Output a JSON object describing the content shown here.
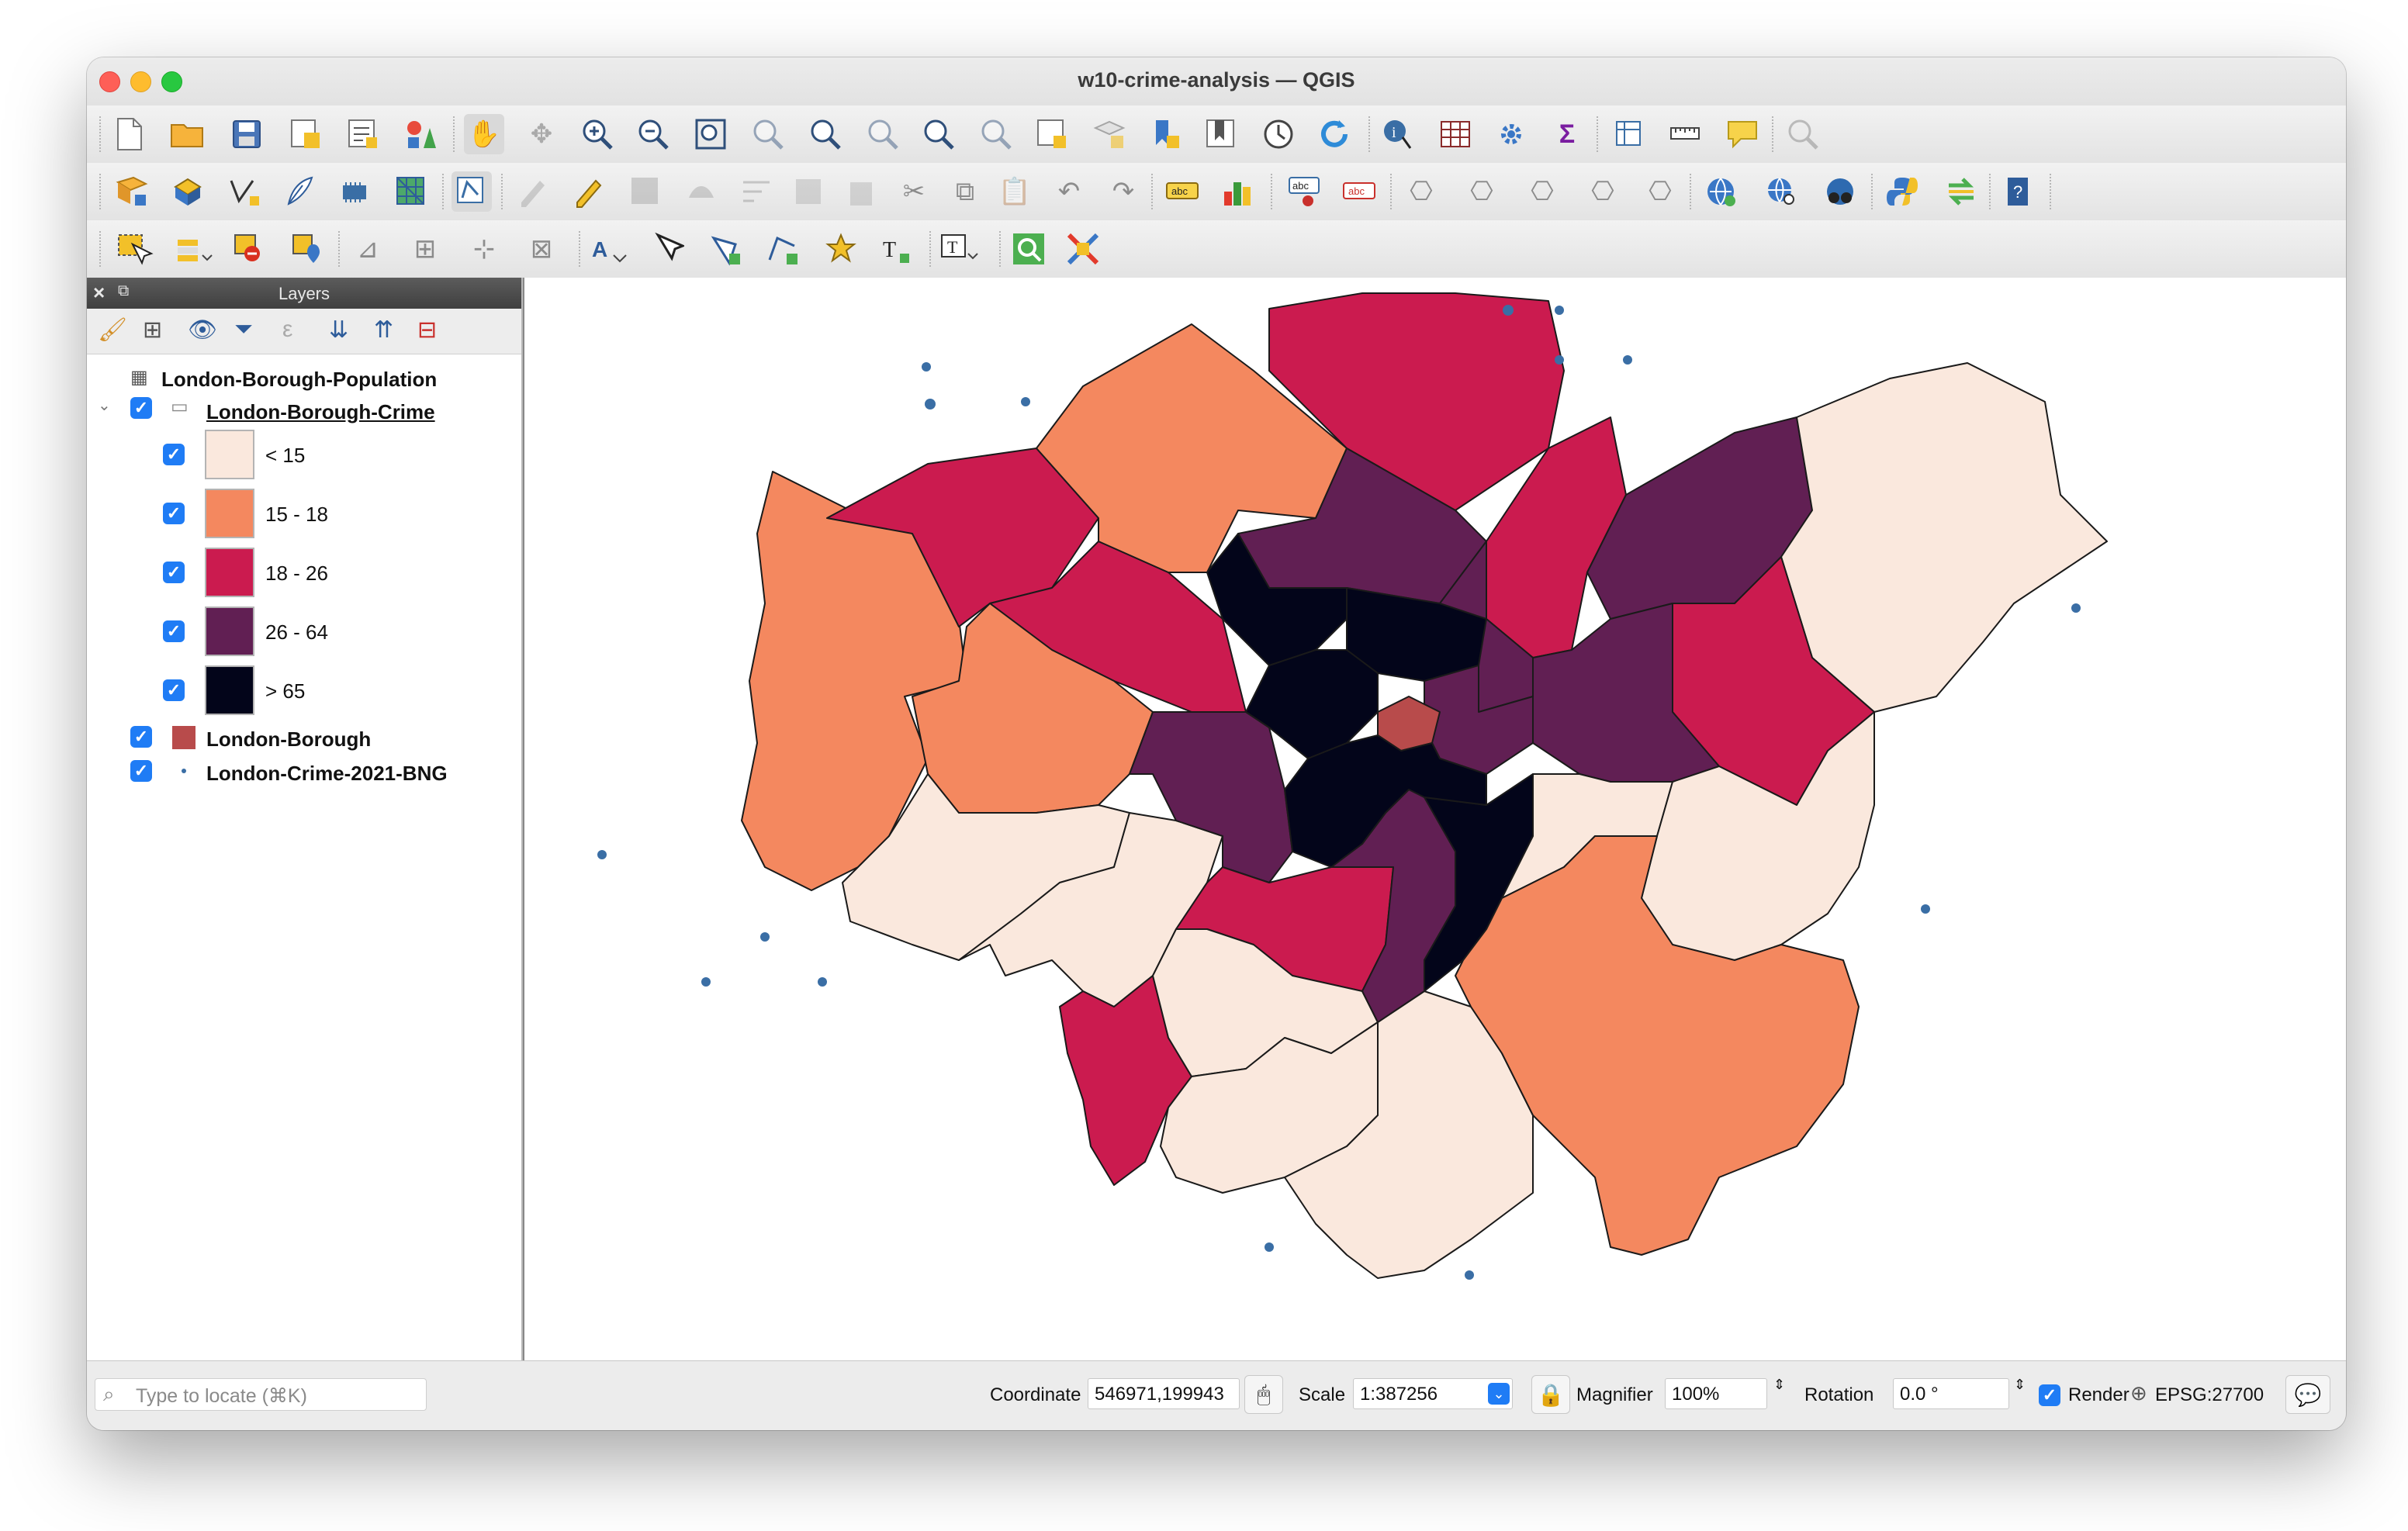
{
  "window": {
    "title": "w10-crime-analysis — QGIS"
  },
  "panel": {
    "title": "Layers"
  },
  "layers": [
    {
      "name": "London-Borough-Population"
    },
    {
      "name": "London-Borough-Crime",
      "legend": [
        {
          "label": "< 15",
          "color": "#fae8dd"
        },
        {
          "label": "15 - 18",
          "color": "#f4885f"
        },
        {
          "label": "18 - 26",
          "color": "#cb1b4f"
        },
        {
          "label": "26 - 64",
          "color": "#611f53"
        },
        {
          "label": "> 65",
          "color": "#03051a"
        }
      ]
    },
    {
      "name": "London-Borough",
      "color": "#b84b4b"
    },
    {
      "name": "London-Crime-2021-BNG",
      "color": "#3a6ea5"
    }
  ],
  "status": {
    "locate_placeholder": "Type to locate (⌘K)",
    "coordinate_label": "Coordinate",
    "coordinate_value": "546971,199943",
    "scale_label": "Scale",
    "scale_value": "1:387256",
    "magnifier_label": "Magnifier",
    "magnifier_value": "100%",
    "rotation_label": "Rotation",
    "rotation_value": "0.0 °",
    "render_label": "Render",
    "crs_value": "EPSG:27700"
  },
  "toolbar_icons": {
    "row1": [
      "new-project-icon",
      "open-project-icon",
      "save-project-icon",
      "save-as-icon",
      "print-layout-icon",
      "style-manager-icon",
      "pan-icon",
      "pan-to-selection-icon",
      "zoom-in-icon",
      "zoom-out-icon",
      "zoom-full-icon",
      "zoom-to-selection-icon",
      "zoom-to-layer-icon",
      "zoom-native-icon",
      "zoom-last-icon",
      "zoom-next-icon",
      "new-map-view-icon",
      "new-3d-view-icon",
      "new-bookmark-icon",
      "show-bookmarks-icon",
      "temporal-controller-icon",
      "refresh-icon",
      "identify-icon",
      "attribute-table-icon",
      "processing-toolbox-icon",
      "statistics-icon",
      "open-field-calculator-icon",
      "measure-icon",
      "map-tips-icon",
      "spatial-bookmark-icon"
    ],
    "row2": [
      "data-source-manager-icon",
      "new-geopackage-layer-icon",
      "digitize-vertex-icon",
      "georeferencer-icon",
      "new-virtual-layer-icon",
      "new-mesh-layer-icon",
      "current-edits-icon",
      "toggle-editing-icon",
      "save-edits-icon",
      "add-feature-icon",
      "vertex-tool-icon",
      "modify-attributes-icon",
      "delete-selected-icon",
      "cut-icon",
      "copy-icon",
      "paste-icon",
      "undo-icon",
      "redo-icon",
      "label-toolbar-icon",
      "diagram-icon",
      "layer-labeling-icon",
      "pin-labels-icon",
      "metasearch-icon",
      "web-globe-icon",
      "globe-search-icon",
      "plugin-icon",
      "python-console-icon",
      "sync-icon",
      "help-icon"
    ],
    "row3": [
      "select-features-icon",
      "select-by-value-icon",
      "deselect-icon",
      "select-by-location-icon",
      "advanced-digitizing-icon",
      "text-annotation-icon",
      "select-annotation-icon",
      "add-polygon-icon",
      "add-line-icon",
      "add-point-icon",
      "add-text-icon",
      "text-format-icon",
      "qgis-search-icon",
      "color-ramp-icon"
    ]
  }
}
